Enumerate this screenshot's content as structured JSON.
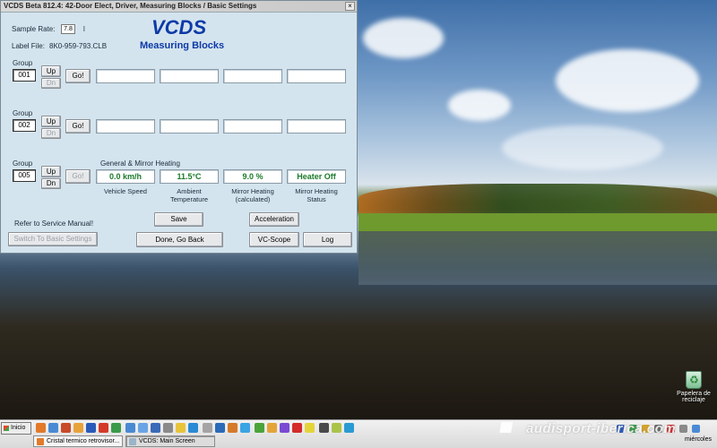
{
  "window": {
    "title": "VCDS Beta 812.4: 42-Door Elect, Driver,  Measuring Blocks / Basic Settings",
    "close_label": "×"
  },
  "header": {
    "sample_rate_label": "Sample Rate:",
    "sample_rate_value": "7.8",
    "sample_rate_suffix": "l",
    "label_file_label": "Label File:",
    "label_file_value": "8K0-959-793.CLB",
    "app_title": "VCDS",
    "subtitle": "Measuring Blocks"
  },
  "groups": [
    {
      "label": "Group",
      "number": "001",
      "up": "Up",
      "dn": "Dn",
      "go": "Go!",
      "title": "",
      "values": [
        "",
        "",
        "",
        ""
      ],
      "captions": [
        "",
        "",
        "",
        ""
      ]
    },
    {
      "label": "Group",
      "number": "002",
      "up": "Up",
      "dn": "Dn",
      "go": "Go!",
      "title": "",
      "values": [
        "",
        "",
        "",
        ""
      ],
      "captions": [
        "",
        "",
        "",
        ""
      ]
    },
    {
      "label": "Group",
      "number": "005",
      "up": "Up",
      "dn": "Dn",
      "go": "Go!",
      "title": "General & Mirror Heating",
      "values": [
        "0.0 km/h",
        "11.5°C",
        "9.0 %",
        "Heater Off"
      ],
      "captions": [
        "Vehicle Speed",
        "Ambient Temperature",
        "Mirror Heating (calculated)",
        "Mirror Heating Status"
      ]
    }
  ],
  "footer": {
    "refer_text": "Refer to Service Manual!",
    "basic_settings": "Switch To Basic Settings",
    "save": "Save",
    "acceleration": "Acceleration",
    "done": "Done, Go Back",
    "vcscope": "VC-Scope",
    "log": "Log"
  },
  "desktop": {
    "recycle_label": "Papelera de reciclaje",
    "watermark": "audisport-iberica.com"
  },
  "taskbar": {
    "start": "Inicio",
    "tasks": [
      "Cristal termico retrovisor...",
      "VCDS:  Main Screen"
    ],
    "clock": "miércoles"
  },
  "colors": {
    "accent_blue": "#0d3aa8",
    "value_green": "#1a7a2a",
    "window_bg": "#d4e4ee"
  }
}
